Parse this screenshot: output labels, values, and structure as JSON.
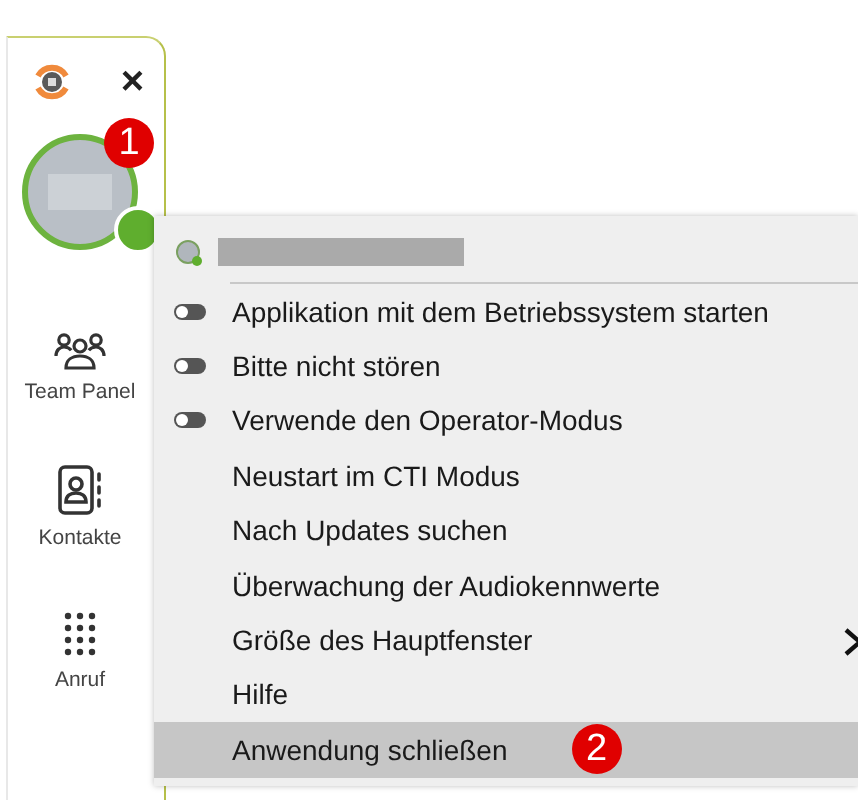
{
  "sidebar": {
    "close": "×",
    "badge": "1",
    "nav": [
      {
        "label": "Team Panel",
        "kind": "team"
      },
      {
        "label": "Kontakte",
        "kind": "contacts"
      },
      {
        "label": "Anruf",
        "kind": "dialpad"
      }
    ]
  },
  "menu": {
    "items": [
      {
        "label": "Applikation mit dem Betriebssystem starten",
        "kind": "toggle",
        "on": false,
        "selected": false
      },
      {
        "label": "Bitte nicht stören",
        "kind": "toggle",
        "on": false,
        "selected": false
      },
      {
        "label": "Verwende den Operator-Modus",
        "kind": "toggle",
        "on": false,
        "selected": false
      },
      {
        "label": "Neustart im CTI Modus",
        "kind": "plain",
        "selected": false
      },
      {
        "label": "Nach Updates suchen",
        "kind": "plain",
        "selected": false
      },
      {
        "label": "Überwachung der Audiokennwerte",
        "kind": "plain",
        "selected": false
      },
      {
        "label": "Größe des Hauptfenster",
        "kind": "submenu",
        "selected": false
      },
      {
        "label": "Hilfe",
        "kind": "plain",
        "selected": false
      },
      {
        "label": "Anwendung schließen",
        "kind": "plain",
        "selected": true,
        "badge": "2"
      }
    ]
  }
}
